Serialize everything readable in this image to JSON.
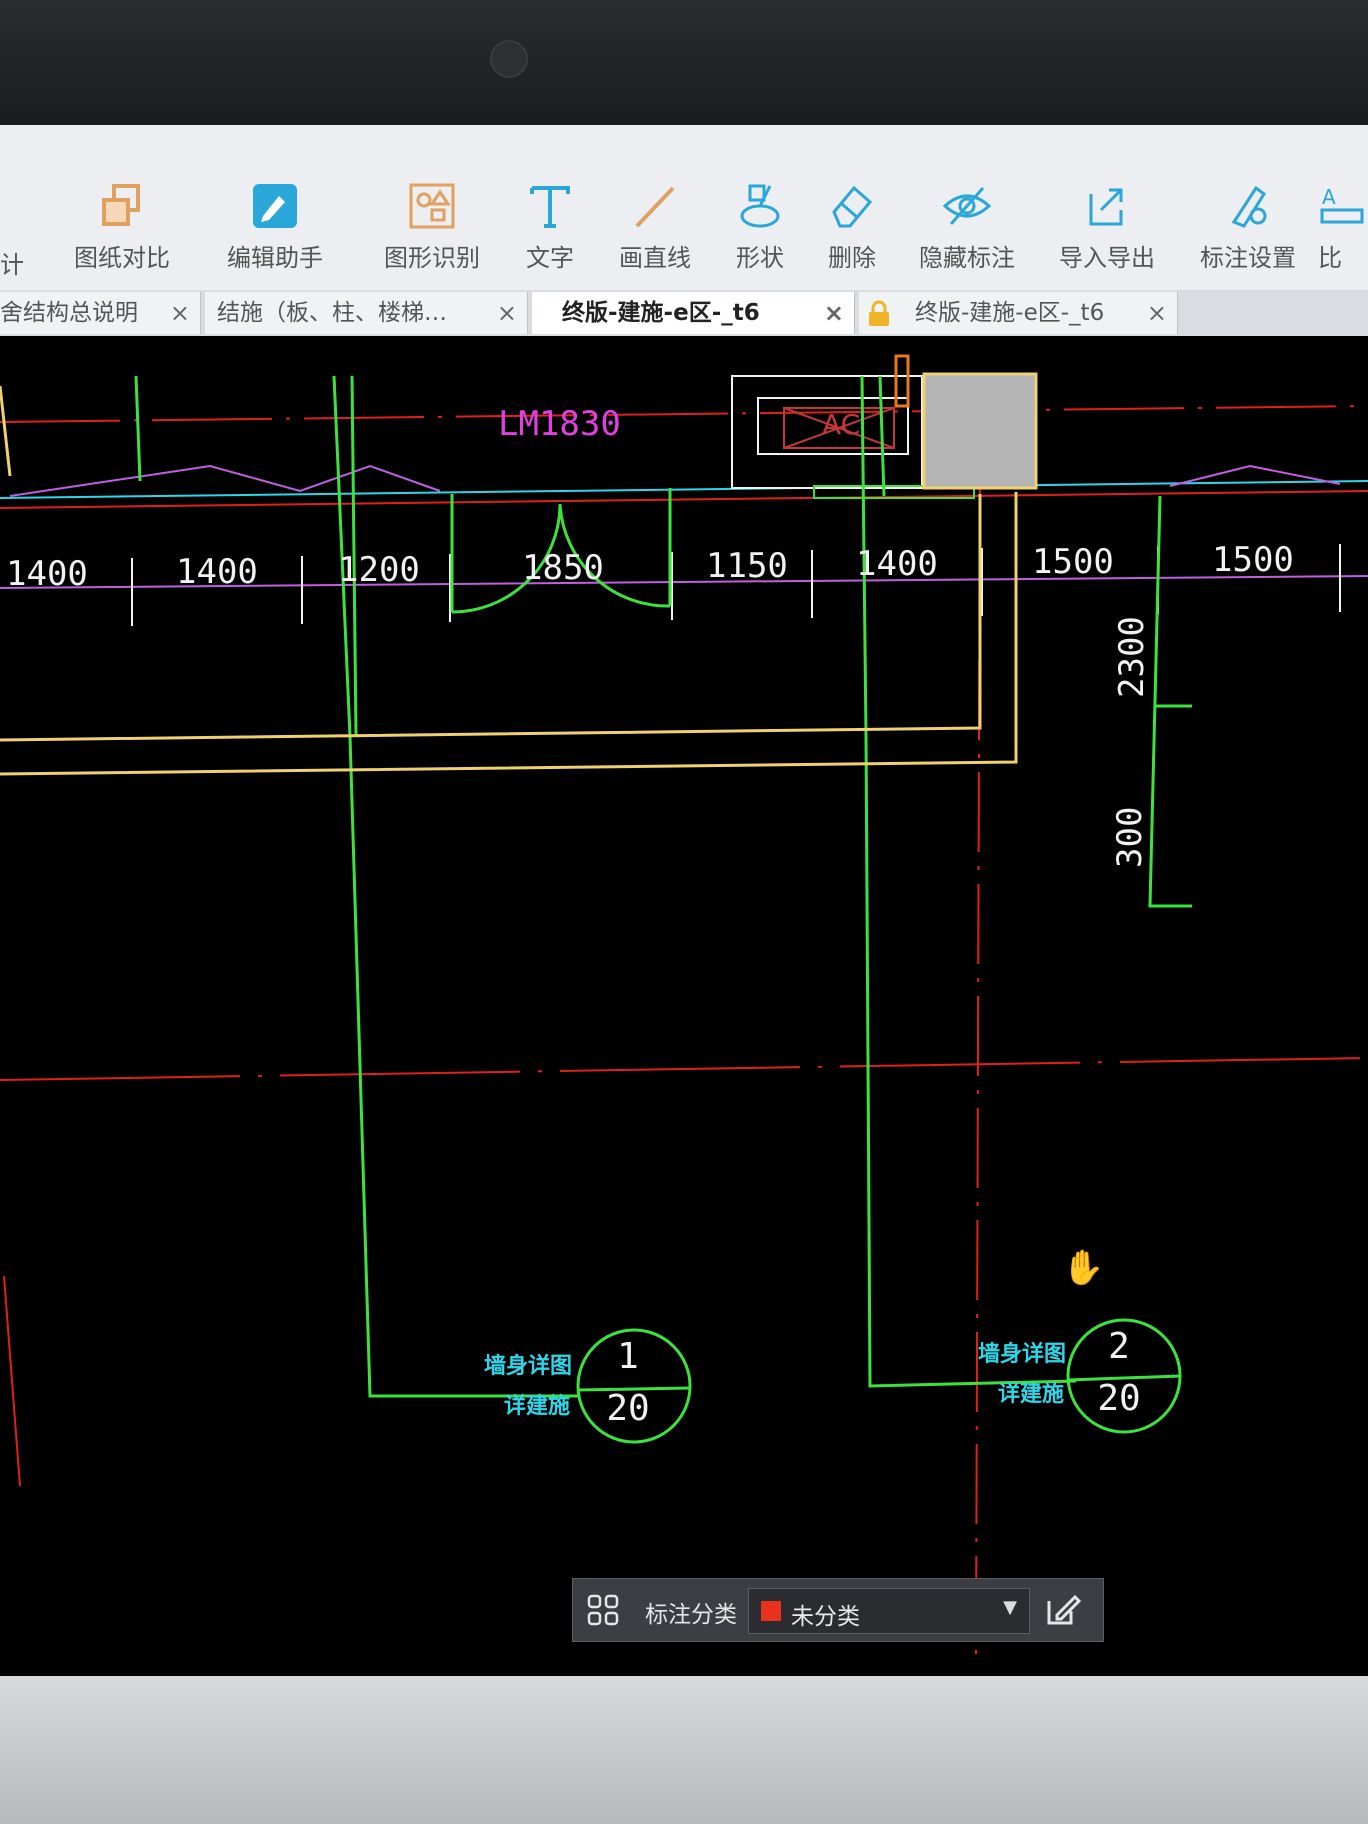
{
  "toolbar": {
    "partial_left": "计",
    "items": [
      {
        "label": "图纸对比",
        "icon": "compare-icon"
      },
      {
        "label": "编辑助手",
        "icon": "edit-assistant-icon"
      },
      {
        "label": "图形识别",
        "icon": "shape-recognition-icon"
      },
      {
        "label": "文字",
        "icon": "text-icon"
      },
      {
        "label": "画直线",
        "icon": "line-icon"
      },
      {
        "label": "形状",
        "icon": "shapes-icon"
      },
      {
        "label": "删除",
        "icon": "eraser-icon"
      },
      {
        "label": "隐藏标注",
        "icon": "hide-eye-icon"
      },
      {
        "label": "导入导出",
        "icon": "import-export-icon"
      },
      {
        "label": "标注设置",
        "icon": "annotation-settings-icon"
      },
      {
        "label": "比",
        "icon": "scale-icon"
      }
    ]
  },
  "tabs": [
    {
      "label": "舍结构总说明",
      "close": "×",
      "active": false
    },
    {
      "label": "结施（板、柱、楼梯…",
      "close": "×",
      "active": false
    },
    {
      "label": "终版-建施-e区-_t6",
      "close": "×",
      "active": true
    },
    {
      "label": "终版-建施-e区-_t6",
      "close": "×",
      "active": false,
      "locked": true
    }
  ],
  "drawing": {
    "door_label": "LM1830",
    "ac_label": "AC",
    "dimensions": [
      "1400",
      "1400",
      "1200",
      "1850",
      "1150",
      "1400",
      "1500",
      "1500"
    ],
    "vertical_dimensions": [
      "2300",
      "300"
    ],
    "detail_markers": [
      {
        "title": "墙身详图",
        "subtitle": "详建施",
        "number": "1",
        "sheet": "20"
      },
      {
        "title": "墙身详图",
        "subtitle": "详建施",
        "number": "2",
        "sheet": "20"
      }
    ]
  },
  "annotation_bar": {
    "label": "标注分类",
    "selected": "未分类",
    "swatch_color": "#e8321e",
    "caret": "▼"
  },
  "cursor": "✋",
  "colors": {
    "toolbar_bg": "#eceef1",
    "canvas_bg": "#000000",
    "axis_red": "#e02020",
    "wall_green": "#3ee23e",
    "dim_magenta": "#c060e0",
    "wall_yellow": "#f0d070",
    "cyan": "#2fd6ea"
  }
}
